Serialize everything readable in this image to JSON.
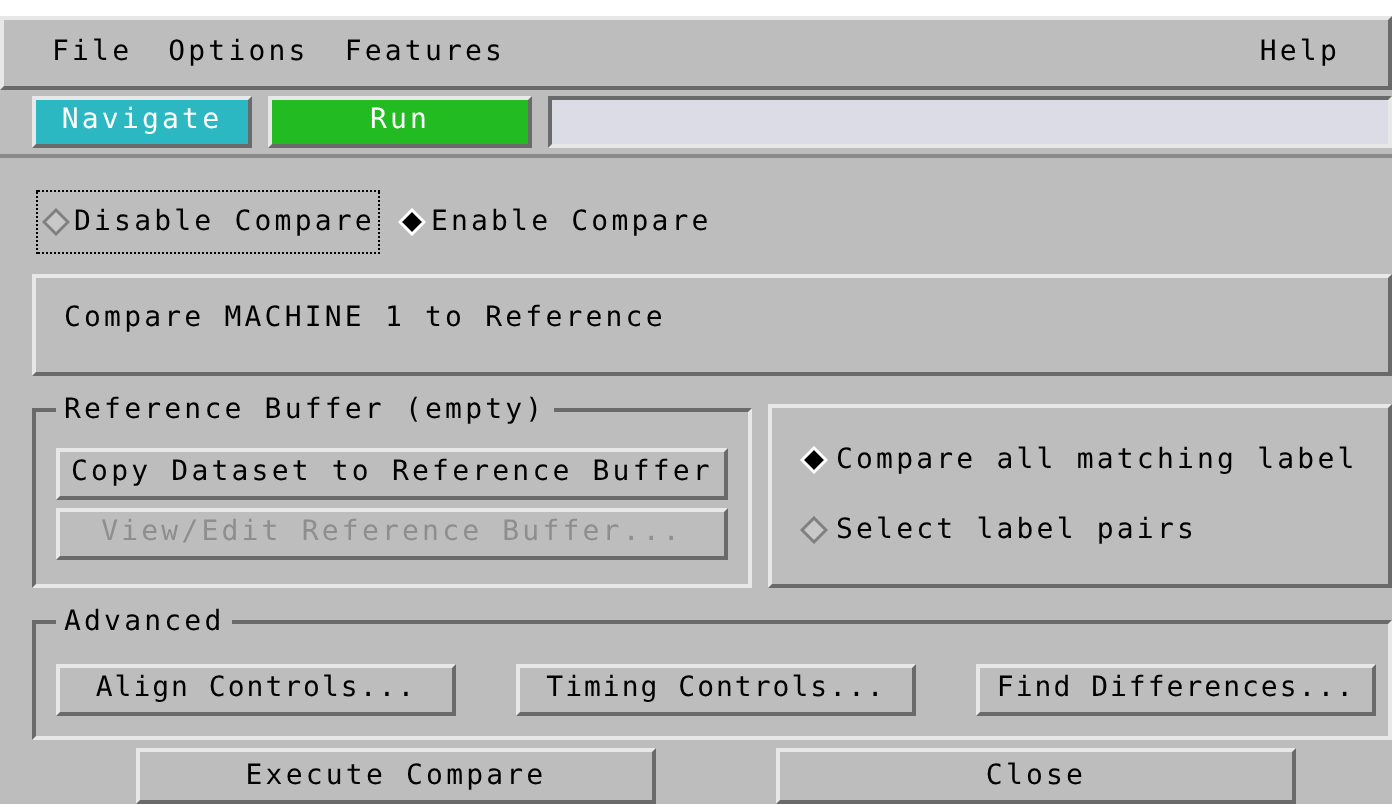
{
  "menu": {
    "items": [
      "File",
      "Options",
      "Features"
    ],
    "help": "Help"
  },
  "toolbar": {
    "buttons": [
      {
        "label": "Navigate",
        "color": "#2bb8c3"
      },
      {
        "label": "Run",
        "color": "#22bb22"
      }
    ]
  },
  "mode": [
    {
      "label": "Disable Compare",
      "selected": false,
      "focused": true
    },
    {
      "label": "Enable Compare",
      "selected": true,
      "focused": false
    }
  ],
  "description": "Compare MACHINE 1 to Reference",
  "reference_buffer": {
    "title": "Reference Buffer (empty)",
    "buttons": [
      {
        "label": "Copy Dataset to Reference Buffer",
        "disabled": false
      },
      {
        "label": "View/Edit Reference Buffer...",
        "disabled": true
      }
    ]
  },
  "label_mode": [
    {
      "label": "Compare all matching label",
      "selected": true
    },
    {
      "label": "Select label pairs",
      "selected": false
    }
  ],
  "advanced": {
    "title": "Advanced",
    "buttons": [
      "Align Controls...",
      "Timing Controls...",
      "Find Differences..."
    ]
  },
  "footer": [
    "Execute Compare",
    "Close"
  ]
}
